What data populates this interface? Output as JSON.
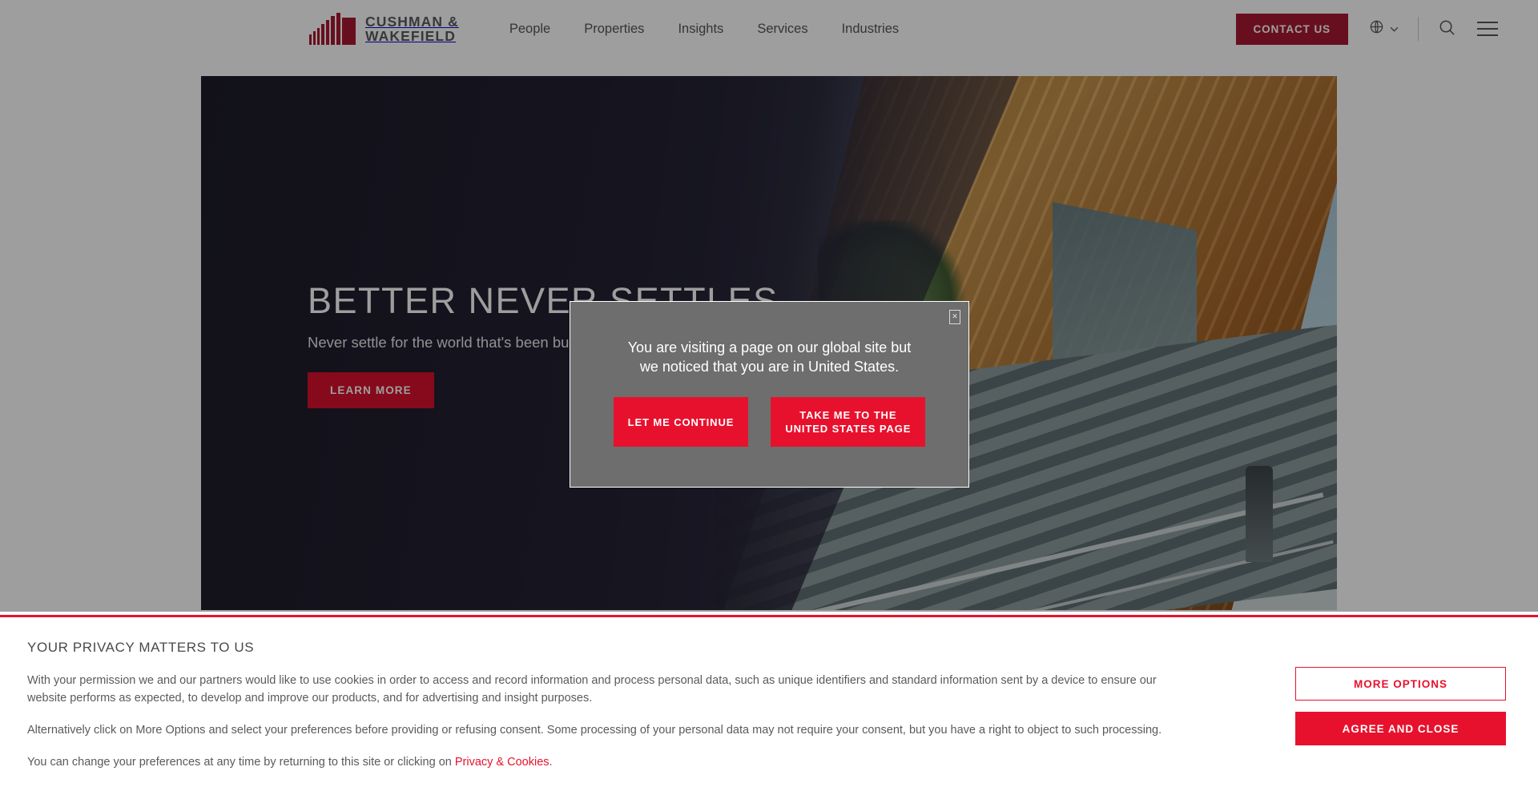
{
  "header": {
    "logo": {
      "line1": "CUSHMAN &",
      "line2": "WAKEFIELD",
      "alt": "Cushman & Wakefield"
    },
    "nav": [
      {
        "label": "People"
      },
      {
        "label": "Properties"
      },
      {
        "label": "Insights"
      },
      {
        "label": "Services"
      },
      {
        "label": "Industries"
      }
    ],
    "contact_label": "CONTACT US",
    "language_icon": "globe-icon",
    "chevron_icon": "chevron-down-icon",
    "search_icon": "search-icon",
    "menu_icon": "hamburger-menu-icon"
  },
  "hero": {
    "title": "BETTER NEVER SETTLES",
    "subtitle": "Never settle for the world that's been built",
    "cta_label": "LEARN MORE"
  },
  "geo_modal": {
    "message_line1": "You are visiting a page on our global site but",
    "message_line2": "we noticed that you are in United States.",
    "close_label": "✕",
    "buttons": [
      {
        "label": "LET ME CONTINUE",
        "name": "let-me-continue-button"
      },
      {
        "label_line1": "TAKE ME TO THE",
        "label_line2": "UNITED STATES PAGE",
        "name": "take-me-to-us-page-button"
      }
    ]
  },
  "privacy": {
    "title": "YOUR PRIVACY MATTERS TO US",
    "paragraph1": "With your permission we and our partners would like to use cookies in order to access and record information and process personal data, such as unique identifiers and standard information sent by a device to ensure our website performs as expected, to develop and improve our products, and for advertising and insight purposes.",
    "paragraph2": "Alternatively click on More Options and select your preferences before providing or refusing consent. Some processing of your personal data may not require your consent, but you have a right to object to such processing.",
    "paragraph3_prefix": "You can change your preferences at any time by returning to this site or clicking on ",
    "paragraph3_link": "Privacy & Cookies",
    "paragraph3_suffix": ".",
    "more_options_label": "MORE OPTIONS",
    "agree_label": "AGREE AND CLOSE"
  },
  "colors": {
    "brand_red": "#e8112d",
    "logo_red": "#a81933",
    "text_gray": "#53565a",
    "modal_gray": "#6e6e6e"
  }
}
